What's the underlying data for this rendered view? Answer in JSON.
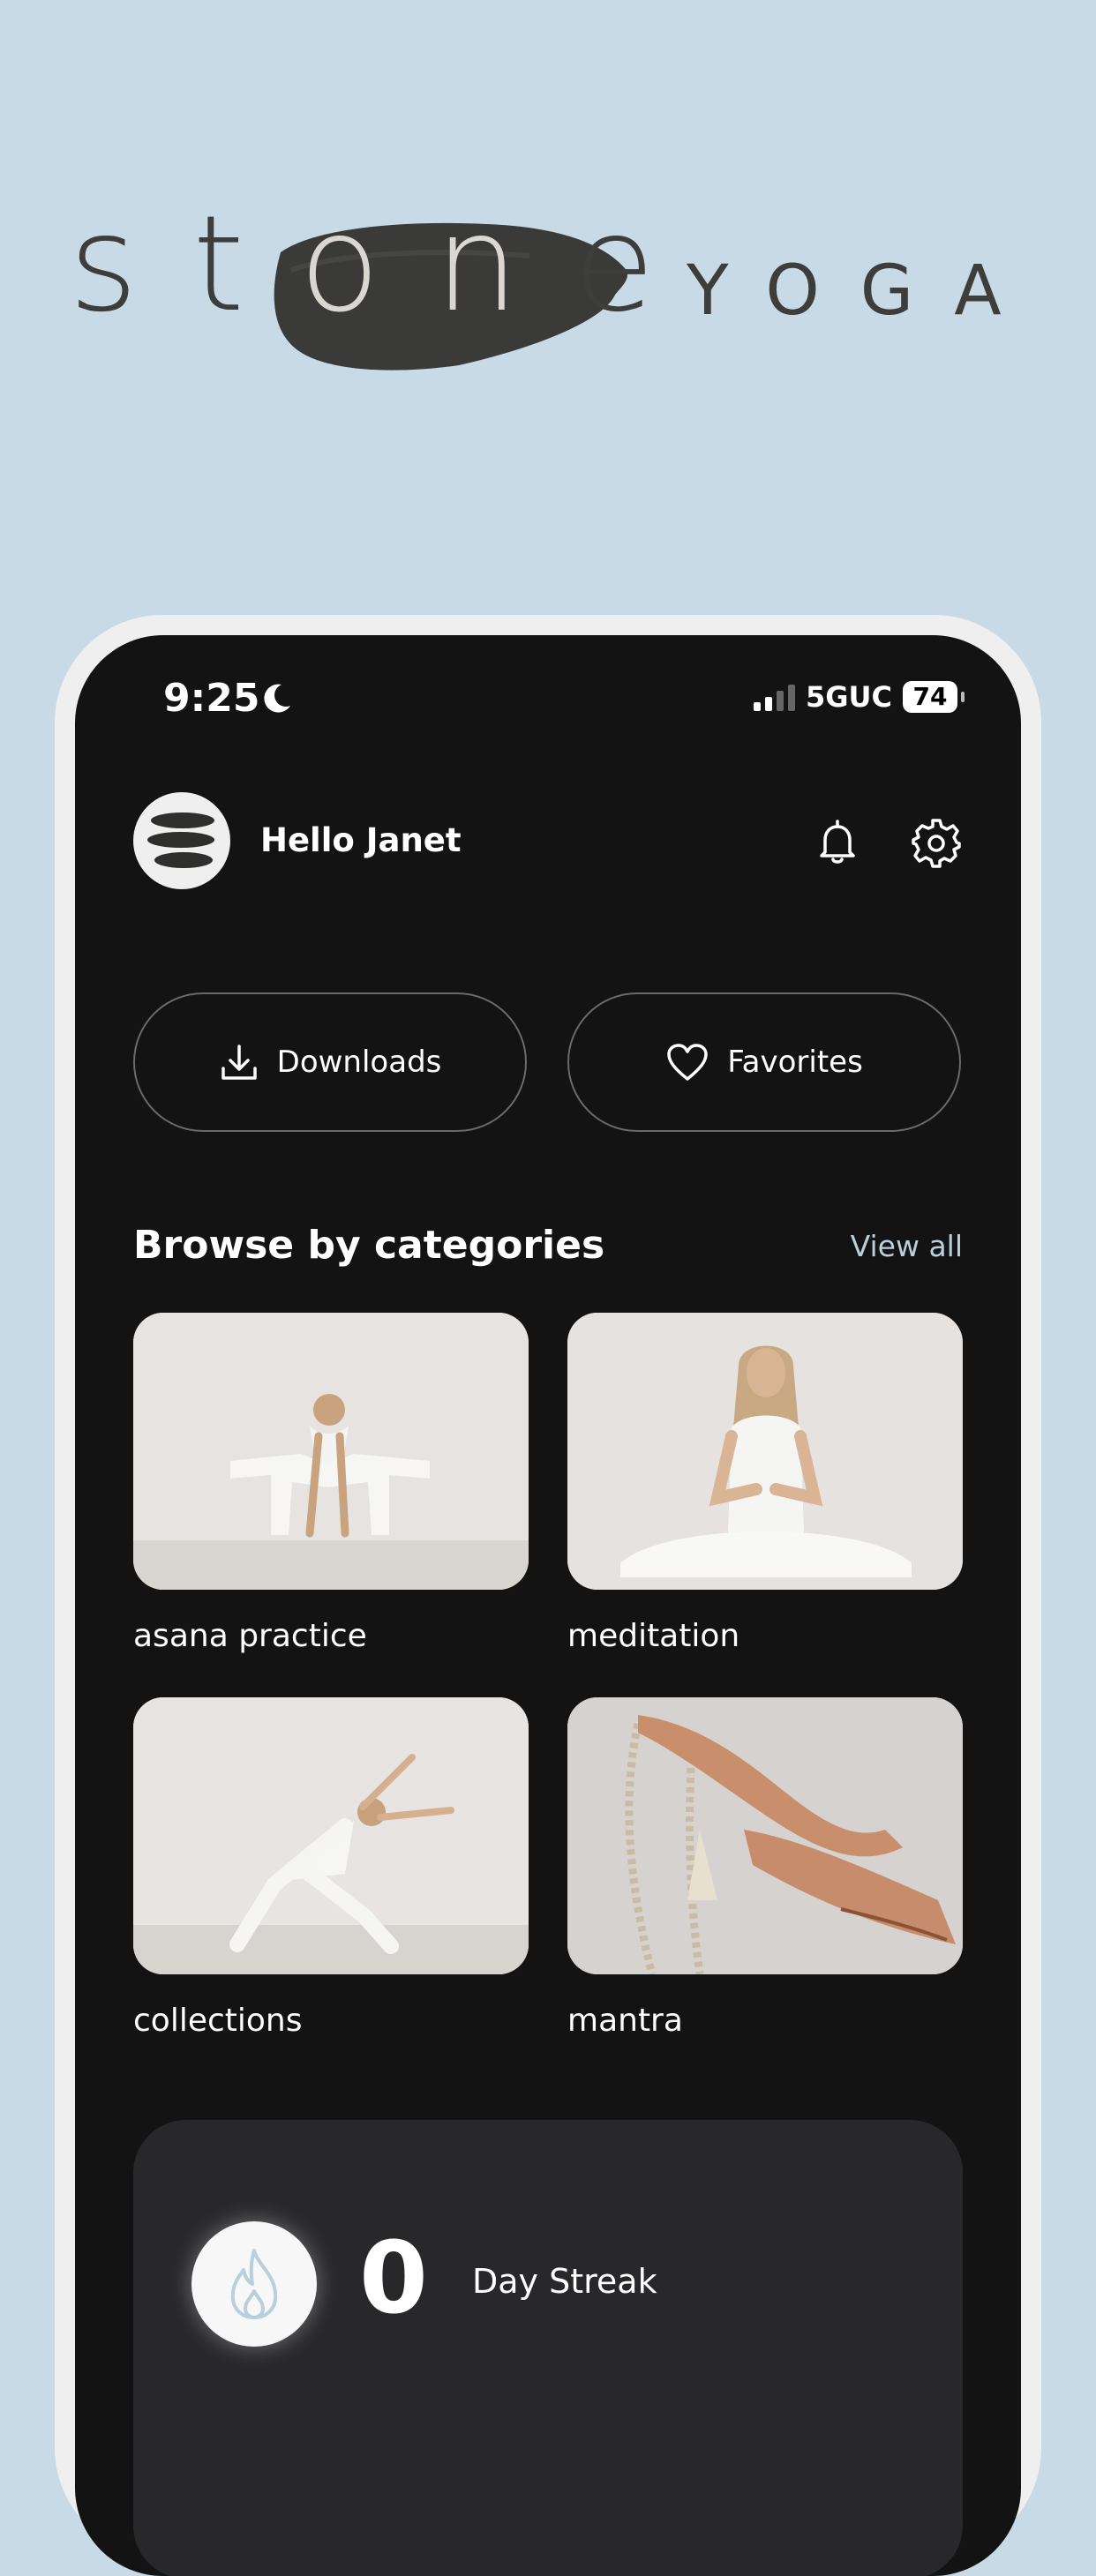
{
  "brand": {
    "word": "stone",
    "word_prefix": "st",
    "word_highlight": "on",
    "word_suffix": "e",
    "secondary": "YOGA"
  },
  "status_bar": {
    "time": "9:25",
    "network": "5GUC",
    "battery": "74"
  },
  "header": {
    "greeting": "Hello Janet"
  },
  "actions": {
    "downloads_label": "Downloads",
    "favorites_label": "Favorites"
  },
  "categories": {
    "title": "Browse by categories",
    "view_all": "View all",
    "items": [
      {
        "label": "asana practice"
      },
      {
        "label": "meditation"
      },
      {
        "label": "collections"
      },
      {
        "label": "mantra"
      }
    ]
  },
  "streak": {
    "count": "0",
    "label": "Day Streak"
  },
  "colors": {
    "background": "#c7dae6",
    "screen": "#131314",
    "accent": "#b9cfdb",
    "card": "#28282b"
  }
}
